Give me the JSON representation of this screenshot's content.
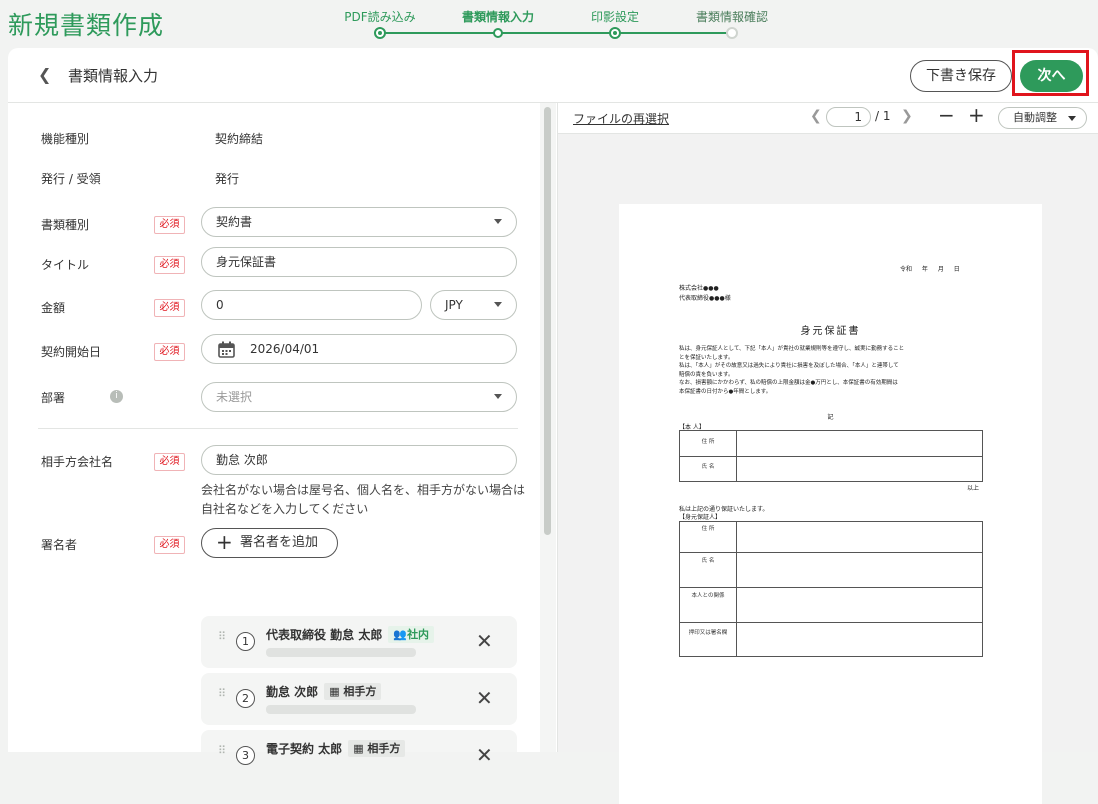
{
  "app_title": "新規書類作成",
  "stepper": {
    "steps": [
      {
        "label": "PDF読み込み",
        "state": "done"
      },
      {
        "label": "書類情報入力",
        "state": "current"
      },
      {
        "label": "印影設定",
        "state": "done"
      },
      {
        "label": "書類情報確認",
        "state": "pending"
      }
    ]
  },
  "header": {
    "back_icon": "chevron-left-icon",
    "title": "書類情報入力",
    "draft_button": "下書き保存",
    "next_button": "次へ"
  },
  "colors": {
    "brand": "#2e9a5b",
    "required": "#e0141c",
    "highlight": "#e0141c"
  },
  "form": {
    "function_type": {
      "label": "機能種別",
      "value": "契約締結"
    },
    "issue_receive": {
      "label": "発行 / 受領",
      "value": "発行"
    },
    "required_badge": "必須",
    "doc_type": {
      "label": "書類種別",
      "value": "契約書"
    },
    "title": {
      "label": "タイトル",
      "value": "身元保証書"
    },
    "amount": {
      "label": "金額",
      "value": "0",
      "currency": "JPY"
    },
    "start_date": {
      "label": "契約開始日",
      "value": "2026/04/01"
    },
    "department": {
      "label": "部署",
      "placeholder": "未選択"
    },
    "counterparty": {
      "label": "相手方会社名",
      "value": "勤怠 次郎",
      "hint": "会社名がない場合は屋号名、個人名を、相手方がない場合は自社名などを入力してください"
    },
    "signers": {
      "label": "署名者",
      "add_button": "署名者を追加",
      "items": [
        {
          "number": "1",
          "name": "代表取締役 勤怠 太郎",
          "tag": "社内",
          "tag_icon": "people-icon"
        },
        {
          "number": "2",
          "name": "勤怠 次郎",
          "tag": "相手方",
          "tag_icon": "building-icon"
        },
        {
          "number": "3",
          "name": "電子契約 太郎",
          "tag": "相手方",
          "tag_icon": "building-icon"
        }
      ]
    }
  },
  "viewer": {
    "reselect_link": "ファイルの再選択",
    "page_current": "1",
    "page_total": "/ 1",
    "zoom": "自動調整"
  },
  "document": {
    "date_line": "令和 年 月 日",
    "addressee_lines": [
      "株式会社●●●",
      "代表取締役●●●様"
    ],
    "title": "身元保証書",
    "body": [
      "私は、身元保証人として、下記「本人」が貴社の就業規則等を遵守し、誠実に勤務すること",
      "とを保証いたします。",
      "私は、「本人」がその故意又は過失により貴社に損害を及ぼした場合、「本人」と連帯して",
      "賠償の責を負います。",
      "なお、損害額にかかわらず、私の賠償の上限金額は金●万円とし、本保証書の有効期間は",
      "本保証書の日付から●年間とします。"
    ],
    "ki": "記",
    "section_person": "【本 人】",
    "person_rows": [
      "住 所",
      "氏 名"
    ],
    "ijou": "以上",
    "guarantee_line": "私は上記の通り保証いたします。",
    "section_guarantor": "【身元保証人】",
    "guarantor_rows": [
      "住 所",
      "氏 名",
      "本人との関係",
      "押印又は署名欄"
    ]
  }
}
